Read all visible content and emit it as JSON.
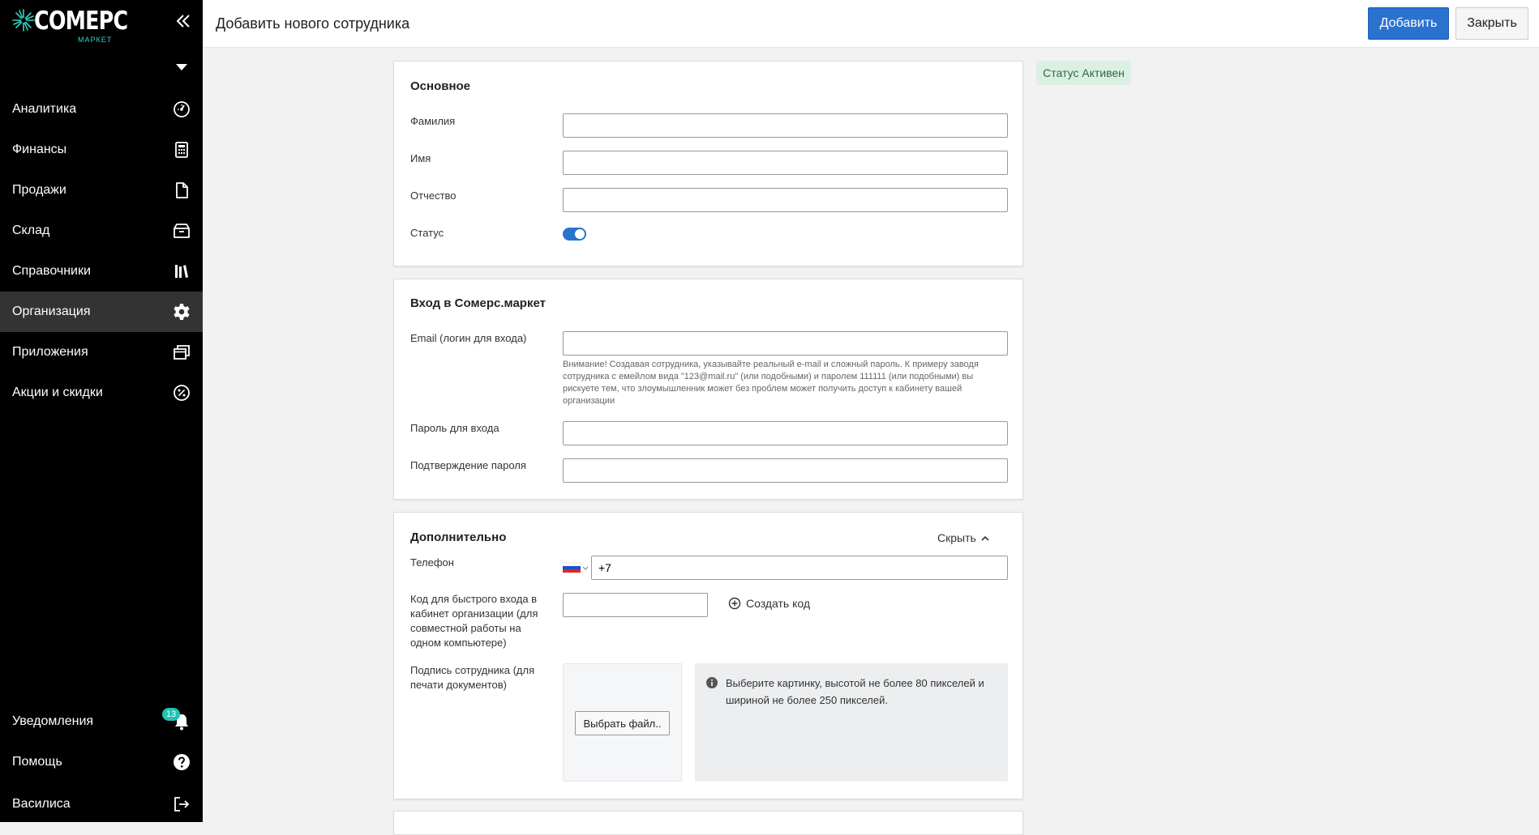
{
  "sidebar": {
    "logo": {
      "word": "СОМЕРС",
      "sub": "МАРКЕТ"
    },
    "items": [
      {
        "label": "Аналитика",
        "icon": "dashboard-icon"
      },
      {
        "label": "Финансы",
        "icon": "calculator-icon"
      },
      {
        "label": "Продажи",
        "icon": "document-icon"
      },
      {
        "label": "Склад",
        "icon": "box-icon"
      },
      {
        "label": "Справочники",
        "icon": "books-icon"
      },
      {
        "label": "Организация",
        "icon": "gear-icon",
        "active": true
      },
      {
        "label": "Приложения",
        "icon": "windows-icon"
      },
      {
        "label": "Акции и скидки",
        "icon": "percent-icon"
      }
    ],
    "bottom": [
      {
        "label": "Уведомления",
        "icon": "bell-icon",
        "badge": "13"
      },
      {
        "label": "Помощь",
        "icon": "help-icon"
      },
      {
        "label": "Василиса",
        "icon": "logout-icon"
      }
    ]
  },
  "header": {
    "title": "Добавить нового сотрудника",
    "add_label": "Добавить",
    "close_label": "Закрыть"
  },
  "status_chip": "Статус Активен",
  "basic": {
    "title": "Основное",
    "last_name_label": "Фамилия",
    "first_name_label": "Имя",
    "middle_name_label": "Отчество",
    "status_label": "Статус",
    "status_on": true
  },
  "login": {
    "title": "Вход в Сомерс.маркет",
    "email_label": "Email (логин для входа)",
    "email_hint": "Внимание! Создавая сотрудника, указывайте реальный e-mail и сложный пароль. К примеру заводя сотрудника с емейлом вида \"123@mail.ru\" (или подобными) и паролем 111111 (или подобными) вы рискуете тем, что злоумышленник может без проблем может получить доступ к кабинету вашей организации",
    "password_label": "Пароль для входа",
    "confirm_label": "Подтверждение пароля"
  },
  "extra": {
    "title": "Дополнительно",
    "hide_label": "Скрыть",
    "phone_label": "Телефон",
    "phone_value": "+7",
    "code_label": "Код для быстрого входа в кабинет организации (для совместной работы на одном компьютере)",
    "create_code_label": "Создать код",
    "signature_label": "Подпись сотрудника (для печати документов)",
    "choose_file_label": "Выбрать файл..",
    "info_text": "Выберите картинку, высотой не более 80 пикселей и шириной не более 250 пикселей."
  },
  "colors": {
    "accent": "#2a72d0",
    "teal": "#1fc4b4",
    "status_bg": "#dcefe3",
    "status_text": "#2d6a45"
  }
}
